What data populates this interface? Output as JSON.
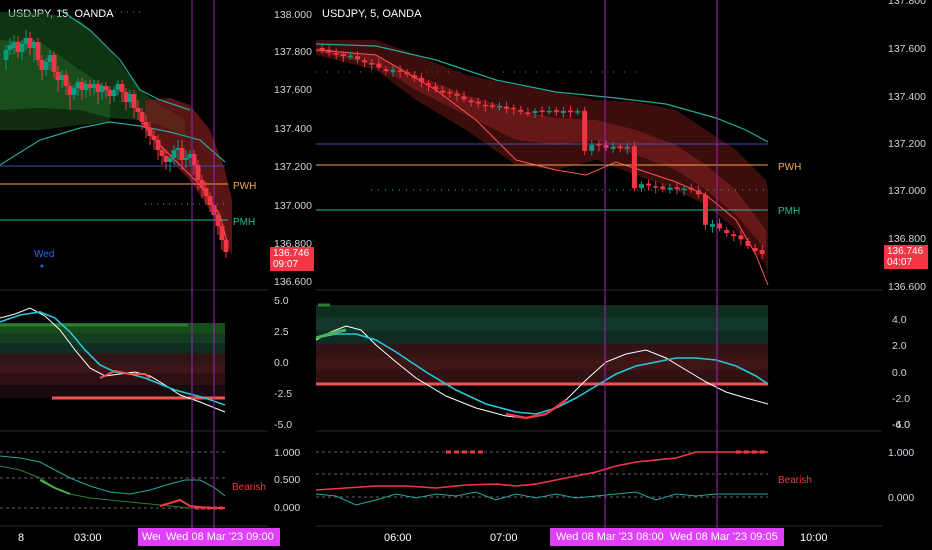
{
  "left_chart": {
    "title": "USDJPY, 15, OANDA",
    "price_ticks": [
      "138.000",
      "137.800",
      "137.600",
      "137.400",
      "137.200",
      "137.000",
      "136.800",
      "136.600"
    ],
    "last_price": "136.746",
    "countdown": "09:07",
    "pwh_label": "PWH",
    "pmh_label": "PMH",
    "day_marker": "Wed",
    "osc_ticks": [
      "5.0",
      "2.5",
      "0.0",
      "-2.5",
      "-5.0"
    ],
    "bottom_ticks": [
      "1.000",
      "0.500",
      "0.000"
    ],
    "bearish_label": "Bearish",
    "time_labels": [
      "8",
      "03:00"
    ],
    "time_cursor_1": "Wed",
    "time_cursor_2": "Wed 08 Mar '23   09:00"
  },
  "right_chart": {
    "title": "USDJPY, 5, OANDA",
    "price_ticks": [
      "137.800",
      "137.600",
      "137.400",
      "137.200",
      "137.000",
      "136.800",
      "136.600"
    ],
    "last_price": "136.746",
    "countdown": "04:07",
    "pwh_label": "PWH",
    "pmh_label": "PMH",
    "osc_ticks": [
      "4.0",
      "2.0",
      "0.0",
      "-2.0",
      "-4.0",
      "-6.0"
    ],
    "bottom_ticks": [
      "1.000",
      "0.000"
    ],
    "bearish_label": "Bearish",
    "time_labels": [
      "06:00",
      "07:00",
      "10:00"
    ],
    "time_cursor_1": "Wed 08 Mar '23   08:00",
    "time_cursor_2": "Wed 08 Mar '23   09:05"
  },
  "colors": {
    "bull": "#089981",
    "bear": "#f23645",
    "pwh": "#f7a74a",
    "pmh": "#1fbf8f",
    "blue_line": "#3f51b5",
    "cursor": "#9c27b0",
    "tag": "#e040fb"
  }
}
